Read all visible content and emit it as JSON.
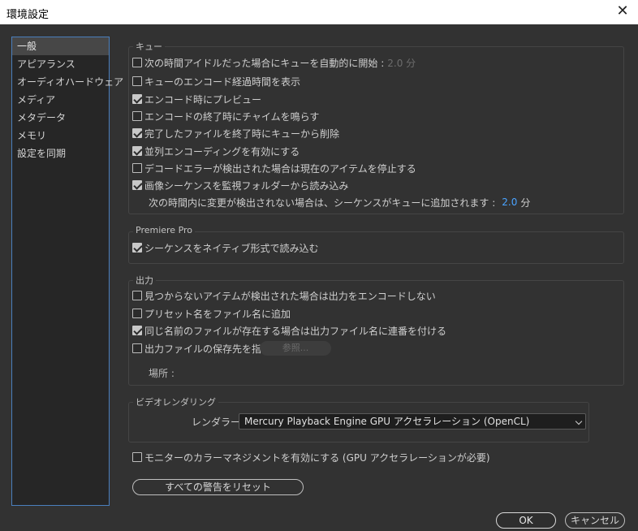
{
  "window": {
    "title": "環境設定",
    "close_glyph": "✕"
  },
  "sidebar": {
    "items": [
      {
        "label": "一般",
        "active": true
      },
      {
        "label": "アピアランス"
      },
      {
        "label": "オーディオハードウェア"
      },
      {
        "label": "メディア"
      },
      {
        "label": "メタデータ"
      },
      {
        "label": "メモリ"
      },
      {
        "label": "設定を同期"
      }
    ]
  },
  "queue": {
    "label": "キュー",
    "options": [
      {
        "label": "次の時間アイドルだった場合にキューを自動的に開始 :",
        "checked": false,
        "value": "2.0 分"
      },
      {
        "label": "キューのエンコード経過時間を表示",
        "checked": false
      },
      {
        "label": "エンコード時にプレビュー",
        "checked": true
      },
      {
        "label": "エンコードの終了時にチャイムを鳴らす",
        "checked": false
      },
      {
        "label": "完了したファイルを終了時にキューから削除",
        "checked": true
      },
      {
        "label": "並列エンコーディングを有効にする",
        "checked": true
      },
      {
        "label": "デコードエラーが検出された場合は現在のアイテムを停止する",
        "checked": false
      },
      {
        "label": "画像シーケンスを監視フォルダーから読み込み",
        "checked": true
      }
    ],
    "sequence_note": "次の時間内に変更が検出されない場合は、シーケンスがキューに追加されます :",
    "sequence_value": "2.0",
    "sequence_unit": "分"
  },
  "premiere": {
    "label": "Premiere Pro",
    "option": {
      "label": "シーケンスをネイティブ形式で読み込む",
      "checked": true
    }
  },
  "output": {
    "label": "出力",
    "options": [
      {
        "label": "見つからないアイテムが検出された場合は出力をエンコードしない",
        "checked": false
      },
      {
        "label": "プリセット名をファイル名に追加",
        "checked": false
      },
      {
        "label": "同じ名前のファイルが存在する場合は出力ファイル名に連番を付ける",
        "checked": true
      },
      {
        "label": "出力ファイルの保存先を指定 :",
        "checked": false
      }
    ],
    "browse_label": "参照...",
    "location_label": "場所 :"
  },
  "video_rendering": {
    "label": "ビデオレンダリング",
    "renderer_label": "レンダラー :",
    "renderer_value": "Mercury Playback Engine GPU アクセラレーション (OpenCL)"
  },
  "color_mgmt": {
    "label": "モニターのカラーマネジメントを有効にする (GPU アクセラレーションが必要)",
    "checked": false
  },
  "reset_warnings_label": "すべての警告をリセット",
  "ok_label": "OK",
  "cancel_label": "キャンセル"
}
